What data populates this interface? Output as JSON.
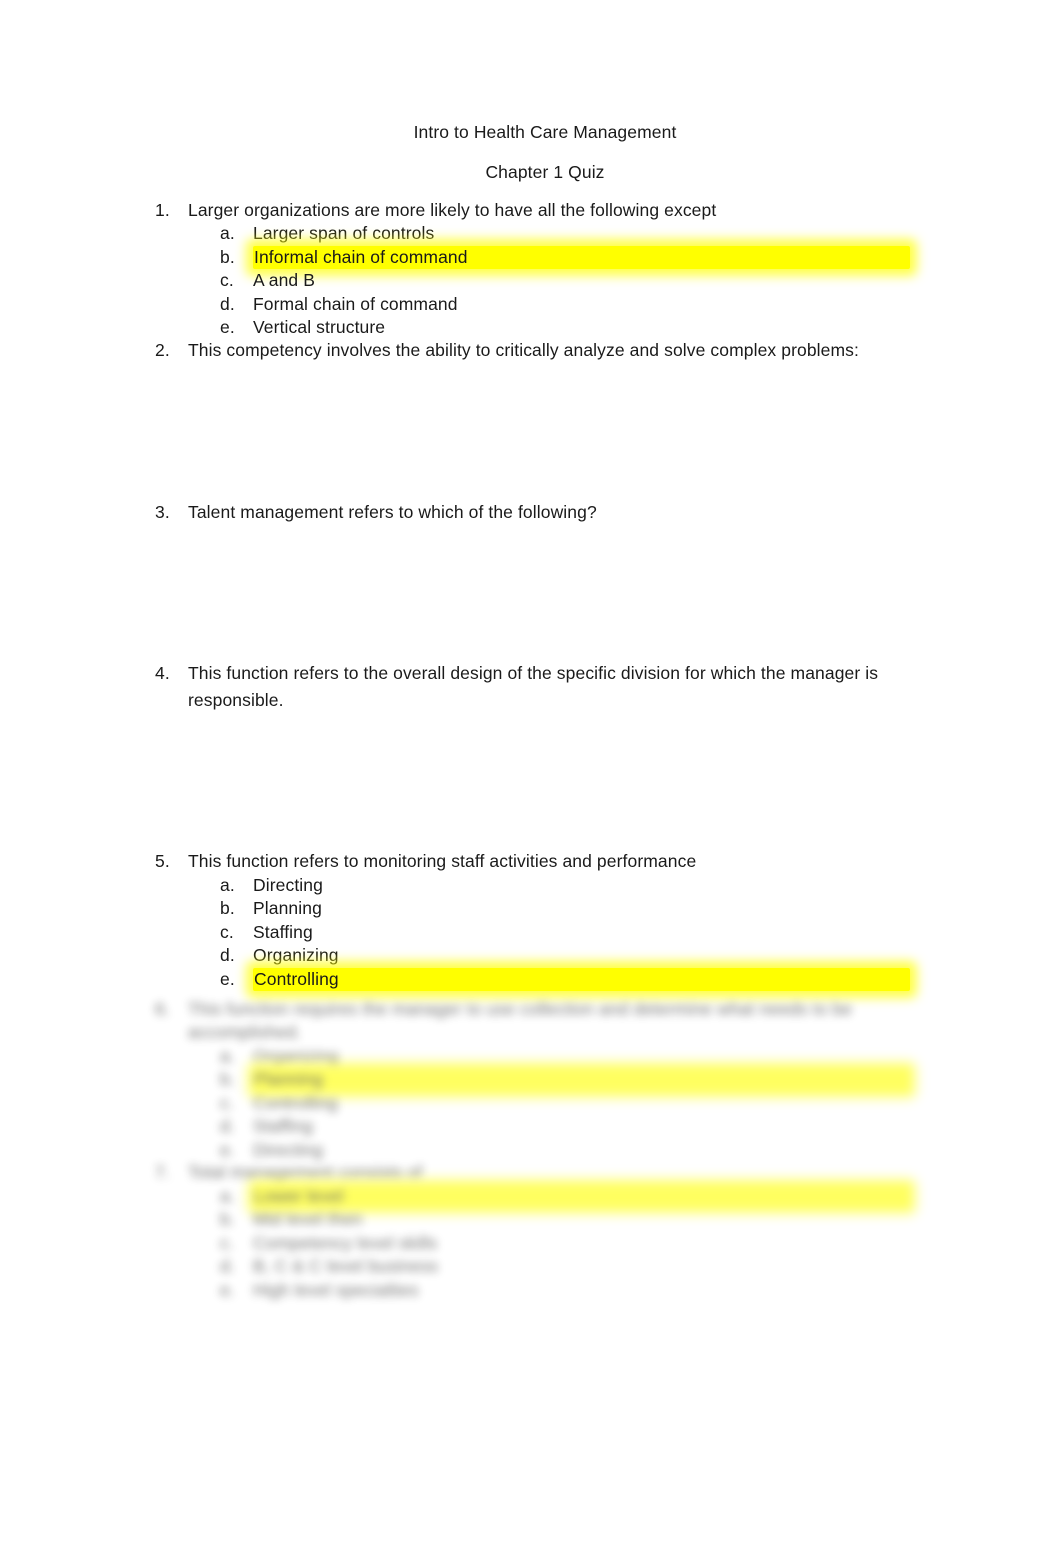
{
  "document": {
    "title": "Intro to Health Care Management",
    "subtitle": "Chapter 1 Quiz",
    "highlight_color": "#ffff00",
    "text_color": "#1a1a1a",
    "background_color": "#ffffff"
  },
  "questions": [
    {
      "number": "1.",
      "text": "Larger organizations are more likely to have all the following except",
      "options": [
        {
          "marker": "a.",
          "text": "Larger span of controls",
          "highlighted": false
        },
        {
          "marker": "b.",
          "text": "Informal chain of command",
          "highlighted": true
        },
        {
          "marker": "c.",
          "text": "A and B",
          "highlighted": false
        },
        {
          "marker": "d.",
          "text": "Formal chain of command",
          "highlighted": false
        },
        {
          "marker": "e.",
          "text": "Vertical structure",
          "highlighted": false
        }
      ]
    },
    {
      "number": "2.",
      "text": "This competency involves the ability to critically analyze and solve complex problems:",
      "options": []
    },
    {
      "number": "3.",
      "text": "Talent management refers to which of the following?",
      "options": []
    },
    {
      "number": "4.",
      "text": "This function refers to the overall design of the specific division for which the manager is",
      "text_line2": "responsible.",
      "options": []
    },
    {
      "number": "5.",
      "text": "This function refers to monitoring staff activities and performance",
      "options": [
        {
          "marker": "a.",
          "text": "Directing",
          "highlighted": false
        },
        {
          "marker": "b.",
          "text": "Planning",
          "highlighted": false
        },
        {
          "marker": "c.",
          "text": "Staffing",
          "highlighted": false
        },
        {
          "marker": "d.",
          "text": "Organizing",
          "highlighted": false
        },
        {
          "marker": "e.",
          "text": "Controlling",
          "highlighted": true
        }
      ]
    },
    {
      "number": "6.",
      "text": "This function requires the manager to use collection and determine what needs to be",
      "text_line2": "accomplished.",
      "illegible": true,
      "options": [
        {
          "marker": "a.",
          "text": "Organizing",
          "highlighted": false
        },
        {
          "marker": "b.",
          "text": "Planning",
          "highlighted": true
        },
        {
          "marker": "c.",
          "text": "Controlling",
          "highlighted": false
        },
        {
          "marker": "d.",
          "text": "Staffing",
          "highlighted": false
        },
        {
          "marker": "e.",
          "text": "Directing",
          "highlighted": false
        }
      ]
    },
    {
      "number": "7.",
      "text": "Total management consists of",
      "illegible": true,
      "options": [
        {
          "marker": "a.",
          "text": "Lower level",
          "highlighted": true
        },
        {
          "marker": "b.",
          "text": "Mid level then",
          "highlighted": false
        },
        {
          "marker": "c.",
          "text": "Competency level skills",
          "highlighted": false
        },
        {
          "marker": "d.",
          "text": "B, C & C level business",
          "highlighted": false
        },
        {
          "marker": "e.",
          "text": "High level specialties",
          "highlighted": false
        }
      ]
    }
  ]
}
